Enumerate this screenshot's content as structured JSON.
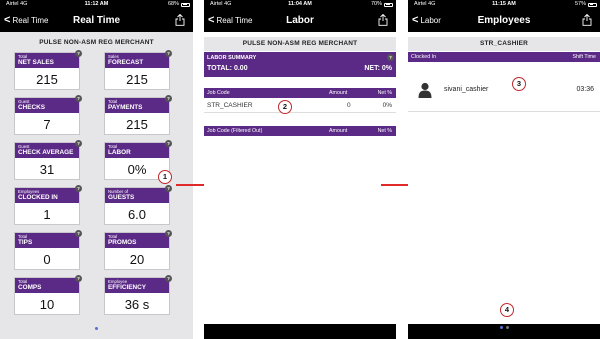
{
  "status_bars": [
    {
      "carrier": "Airtel",
      "network": "4G",
      "time": "11:12 AM",
      "battery": "68%",
      "battery_fraction": 0.68
    },
    {
      "carrier": "Airtel",
      "network": "4G",
      "time": "11:04 AM",
      "battery": "70%",
      "battery_fraction": 0.7
    },
    {
      "carrier": "Airtel",
      "network": "4G",
      "time": "11:15 AM",
      "battery": "57%",
      "battery_fraction": 0.57
    }
  ],
  "screen1": {
    "back_label": "Real Time",
    "title": "Real Time",
    "merchant": "PULSE NON-ASM REG MERCHANT",
    "tiles": [
      {
        "sub": "Total",
        "title": "NET SALES",
        "value": "215"
      },
      {
        "sub": "Sales",
        "title": "FORECAST",
        "value": "215"
      },
      {
        "sub": "Guest",
        "title": "CHECKS",
        "value": "7"
      },
      {
        "sub": "Total",
        "title": "PAYMENTS",
        "value": "215"
      },
      {
        "sub": "Guest",
        "title": "CHECK AVERAGE",
        "value": "31"
      },
      {
        "sub": "Total",
        "title": "LABOR",
        "value": "0%"
      },
      {
        "sub": "Employees",
        "title": "CLOCKED IN",
        "value": "1"
      },
      {
        "sub": "Number of",
        "title": "GUESTS",
        "value": "6.0"
      },
      {
        "sub": "Total",
        "title": "TIPS",
        "value": "0"
      },
      {
        "sub": "Total",
        "title": "PROMOS",
        "value": "20"
      },
      {
        "sub": "Total",
        "title": "COMPS",
        "value": "10"
      },
      {
        "sub": "Employee",
        "title": "EFFICIENCY",
        "value": "36 s"
      }
    ],
    "info_glyph": "?",
    "callout": "1"
  },
  "screen2": {
    "back_label": "Real Time",
    "title": "Labor",
    "merchant": "PULSE NON-ASM REG MERCHANT",
    "summary_title": "LABOR SUMMARY",
    "total": "TOTAL: 0.00",
    "net": "NET: 0%",
    "columns": [
      "Job Code",
      "Amount",
      "Net %"
    ],
    "rows": [
      {
        "job": "STR_CASHIER",
        "amount": "0",
        "net": "0%"
      }
    ],
    "filtered_columns": [
      "Job Code (Filtered Out)",
      "Amount",
      "Net %"
    ],
    "callout": "2"
  },
  "screen3": {
    "back_label": "Labor",
    "title": "Employees",
    "job_code": "STR_CASHIER",
    "columns": [
      "Clocked In",
      "Shift Time"
    ],
    "employees": [
      {
        "name": "sivani_cashier",
        "shift_time": "03:36"
      }
    ],
    "callout_employee": "3",
    "callout_bottom": "4"
  },
  "colors": {
    "accent": "#5b2a86",
    "arrow": "#e02a2a",
    "callout_ring": "#c0282d"
  }
}
